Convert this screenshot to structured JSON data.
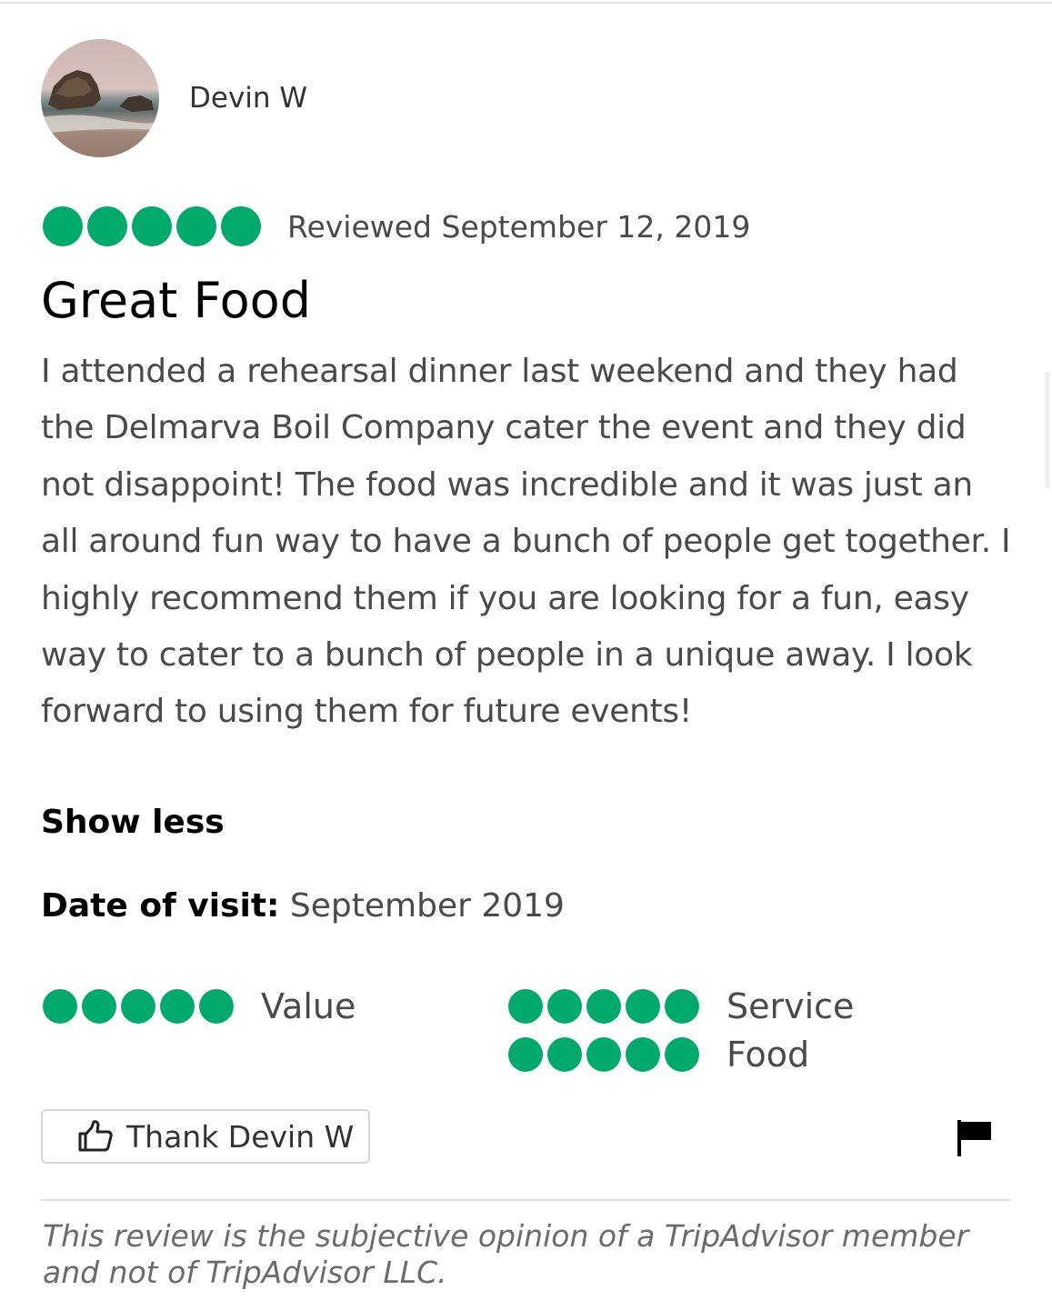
{
  "reviewer": {
    "name": "Devin W",
    "avatar_icon": "avatar-beach-photo"
  },
  "review": {
    "rating": 5,
    "rating_max": 5,
    "reviewed_date": "Reviewed September 12, 2019",
    "title": "Great Food",
    "body": "I attended a rehearsal dinner last weekend and they had the Delmarva Boil Company cater the event and they did not disappoint! The food was incredible and it was just an all around fun way to have a bunch of people get together. I highly recommend them if you are looking for a fun, easy way to cater to a bunch of people in a unique away. I look forward to using them for future events!",
    "show_less_label": "Show less",
    "date_of_visit_label": "Date of visit:",
    "date_of_visit_value": "September 2019"
  },
  "sub_ratings": [
    {
      "label": "Value",
      "rating": 5
    },
    {
      "label": "Service",
      "rating": 5
    },
    {
      "label": "Food",
      "rating": 5
    }
  ],
  "actions": {
    "thank_label": "Thank Devin W",
    "thank_icon": "thumbs-up-icon",
    "report_icon": "flag-icon"
  },
  "disclaimer": "This review is the subjective opinion of a TripAdvisor member and not of TripAdvisor LLC.",
  "colors": {
    "bubble_green": "#00aa6c",
    "text_dark": "#000000",
    "text_body": "#4a4a4a",
    "text_muted": "#6b6b6b"
  }
}
